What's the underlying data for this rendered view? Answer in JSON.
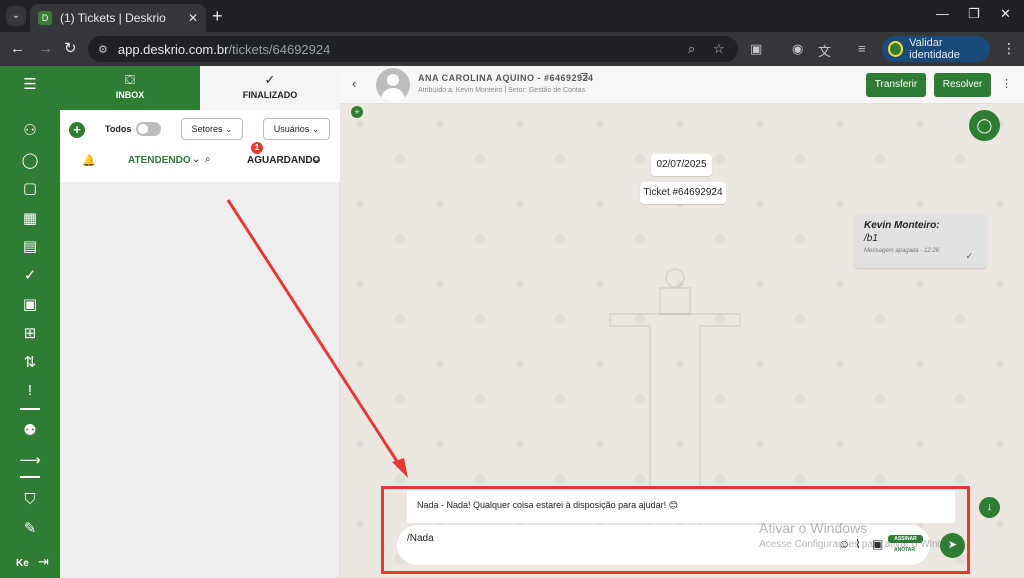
{
  "browser": {
    "tab_title": "(1) Tickets | Deskrio",
    "url_host": "app.deskrio.com.br",
    "url_path": "/tickets/64692924",
    "validar_label": "Validar identidade"
  },
  "sidebar": {
    "user_initials": "Ke"
  },
  "ticket_panel": {
    "tabs": [
      {
        "label": "INBOX"
      },
      {
        "label": "FINALIZADO"
      }
    ],
    "todos_label": "Todos",
    "setores_label": "Setores",
    "usuarios_label": "Usuários",
    "atendendo_label": "ATENDENDO",
    "aguardando_label": "AGUARDANDO",
    "aguardando_badge": "1"
  },
  "chat": {
    "contact_name": "ANA CAROLINA AQUINO - #64692924",
    "contact_sub": "Atribuído a: Kevin Monteiro | Setor: Gestão de Contas",
    "transferir_label": "Transferir",
    "resolver_label": "Resolver",
    "date_label": "02/07/2025",
    "ticket_label": "Ticket #64692924",
    "message": {
      "author": "Kevin Monteiro",
      "text": "/b1",
      "meta": "Mensagem apagada -",
      "time": "12:26"
    },
    "suggestion_text": "Nada - Nada! Qualquer coisa estarei à disposição para ajudar! 😊",
    "compose_value": "/Nada",
    "watermark_title": "Ativar o Windows",
    "watermark_sub": "Acesse Configurações para ativar o Windows.",
    "assinar_label": "ASSINAR",
    "anotar_label": "ANOTAR"
  },
  "colors": {
    "brand_green": "#2e7d32",
    "annotation_red": "#e53935"
  },
  "icons": {
    "sidebar": [
      "menu-icon",
      "user-icon",
      "chat-icon",
      "contact-card-icon",
      "dashboard-icon",
      "kanban-icon",
      "check-circle-icon",
      "calendar-icon",
      "add-message-icon",
      "flow-icon",
      "alert-message-icon",
      "users-icon",
      "arrow-right-icon",
      "shield-icon",
      "edit-icon"
    ]
  }
}
